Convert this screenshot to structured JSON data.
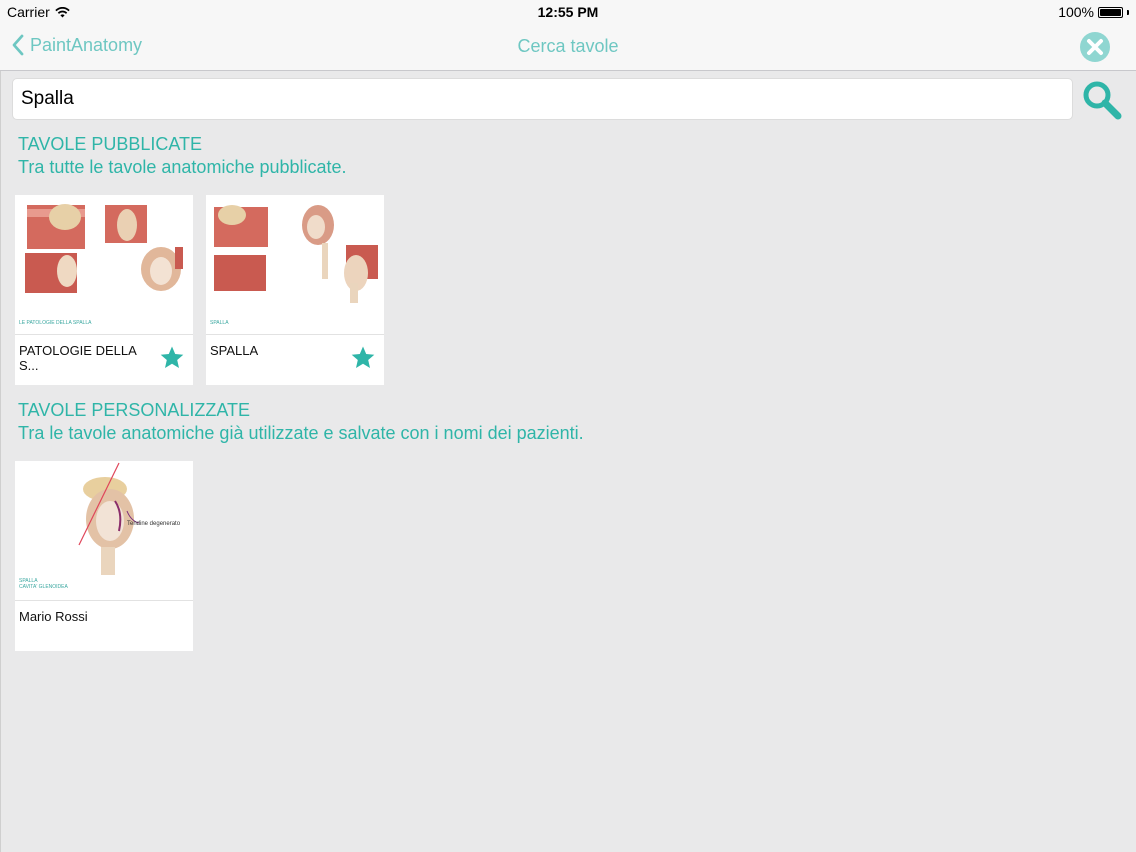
{
  "status_bar": {
    "carrier": "Carrier",
    "time": "12:55 PM",
    "battery": "100%"
  },
  "nav": {
    "back_label": "PaintAnatomy",
    "title": "Cerca tavole",
    "close_icon": "close-circle-icon"
  },
  "search": {
    "value": "Spalla",
    "icon": "search-icon"
  },
  "sections": {
    "published": {
      "title": "TAVOLE PUBBLICATE",
      "subtitle": "Tra tutte le tavole anatomiche pubblicate.",
      "cards": [
        {
          "label": "PATOLOGIE DELLA S...",
          "favorite": true,
          "caption": "LE PATOLOGIE DELLA SPALLA"
        },
        {
          "label": "SPALLA",
          "favorite": true,
          "caption": "SPALLA"
        }
      ]
    },
    "custom": {
      "title": "TAVOLE PERSONALIZZATE",
      "subtitle": "Tra le tavole anatomiche già utilizzate e salvate con i nomi dei pazienti.",
      "cards": [
        {
          "label": "Mario Rossi",
          "caption_1": "SPALLA",
          "caption_2": "CAVITA' GLENOIDEA",
          "annotation": "Tendine degenerato"
        }
      ]
    }
  },
  "colors": {
    "accent": "#2fb5a8",
    "nav_tint": "#6ec7c2",
    "background": "#e9e9ea"
  }
}
